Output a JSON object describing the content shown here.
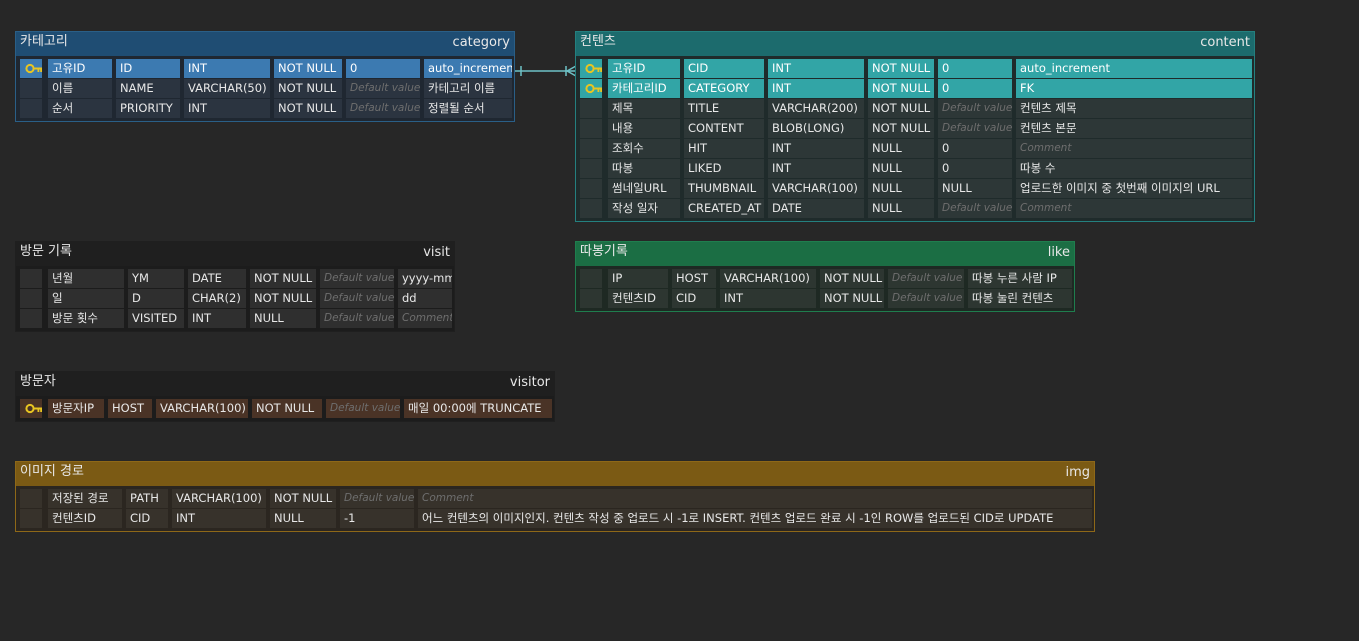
{
  "colors": {
    "category": {
      "head": "#1f4d73",
      "border": "#2a5f87",
      "body": "#1f2731",
      "cell": "#2b3440",
      "sel": "#3c7ab1"
    },
    "content": {
      "head": "#1c6b6d",
      "border": "#24807f",
      "body": "#1f2b2b",
      "cell": "#2d3737",
      "sel": "#32a5a6"
    },
    "visit": {
      "head": "#1f1f1f",
      "border": "#1f1f1f",
      "body": "#1c1c1c",
      "cell": "#2f2f2f",
      "sel": "#3a3a3a"
    },
    "like": {
      "head": "#1b6e44",
      "border": "#1f7e4e",
      "body": "#1e2923",
      "cell": "#2d3631",
      "sel": "#2d8d5b"
    },
    "visitor": {
      "head": "#1f1f1f",
      "border": "#1f1f1f",
      "body": "#1c1c1c",
      "cell": "#4a3326",
      "sel": "#4a3326"
    },
    "img": {
      "head": "#7b5a14",
      "border": "#8e6818",
      "body": "#2b2620",
      "cell": "#37322b",
      "sel": "#5a4419"
    },
    "key": "#e8c521",
    "connector": "#6ec2c7"
  },
  "tables": {
    "category": {
      "title": "카테고리",
      "name": "category",
      "rows": [
        {
          "key": true,
          "selected": true,
          "cells": [
            "고유ID",
            "ID",
            "INT",
            "NOT NULL",
            "0",
            "auto_increment"
          ]
        },
        {
          "key": false,
          "selected": false,
          "cells": [
            "이름",
            "NAME",
            "VARCHAR(50)",
            "NOT NULL",
            "Default value",
            "카테고리 이름"
          ],
          "ph": [
            4
          ]
        },
        {
          "key": false,
          "selected": false,
          "cells": [
            "순서",
            "PRIORITY",
            "INT",
            "NOT NULL",
            "Default value",
            "정렬될 순서"
          ],
          "ph": [
            4
          ]
        }
      ]
    },
    "content": {
      "title": "컨텐츠",
      "name": "content",
      "rows": [
        {
          "key": true,
          "selected": true,
          "cells": [
            "고유ID",
            "CID",
            "INT",
            "NOT NULL",
            "0",
            "auto_increment"
          ]
        },
        {
          "key": true,
          "selected": true,
          "cells": [
            "카테고리ID",
            "CATEGORY",
            "INT",
            "NOT NULL",
            "0",
            "FK"
          ]
        },
        {
          "key": false,
          "selected": false,
          "cells": [
            "제목",
            "TITLE",
            "VARCHAR(200)",
            "NOT NULL",
            "Default value",
            "컨텐츠 제목"
          ],
          "ph": [
            4
          ]
        },
        {
          "key": false,
          "selected": false,
          "cells": [
            "내용",
            "CONTENT",
            "BLOB(LONG)",
            "NOT NULL",
            "Default value",
            "컨텐츠 본문"
          ],
          "ph": [
            4
          ]
        },
        {
          "key": false,
          "selected": false,
          "cells": [
            "조회수",
            "HIT",
            "INT",
            "NULL",
            "0",
            "Comment"
          ],
          "ph": [
            5
          ]
        },
        {
          "key": false,
          "selected": false,
          "cells": [
            "따봉",
            "LIKED",
            "INT",
            "NULL",
            "0",
            "따봉 수"
          ]
        },
        {
          "key": false,
          "selected": false,
          "cells": [
            "썸네일URL",
            "THUMBNAIL",
            "VARCHAR(100)",
            "NULL",
            "NULL",
            "업로드한 이미지 중 첫번째 이미지의 URL"
          ]
        },
        {
          "key": false,
          "selected": false,
          "cells": [
            "작성 일자",
            "CREATED_AT",
            "DATE",
            "NULL",
            "Default value",
            "Comment"
          ],
          "ph": [
            4,
            5
          ]
        }
      ]
    },
    "visit": {
      "title": "방문 기록",
      "name": "visit",
      "rows": [
        {
          "key": false,
          "selected": false,
          "cells": [
            "년월",
            "YM",
            "DATE",
            "NOT NULL",
            "Default value",
            "yyyy-mm"
          ],
          "ph": [
            4
          ]
        },
        {
          "key": false,
          "selected": false,
          "cells": [
            "일",
            "D",
            "CHAR(2)",
            "NOT NULL",
            "Default value",
            "dd"
          ],
          "ph": [
            4
          ]
        },
        {
          "key": false,
          "selected": false,
          "cells": [
            "방문 횟수",
            "VISITED",
            "INT",
            "NULL",
            "Default value",
            "Comment"
          ],
          "ph": [
            4,
            5
          ]
        }
      ]
    },
    "like": {
      "title": "따봉기록",
      "name": "like",
      "rows": [
        {
          "key": false,
          "selected": false,
          "cells": [
            "IP",
            "HOST",
            "VARCHAR(100)",
            "NOT NULL",
            "Default value",
            "따봉 누른 사람 IP"
          ],
          "ph": [
            4
          ]
        },
        {
          "key": false,
          "selected": false,
          "cells": [
            "컨텐츠ID",
            "CID",
            "INT",
            "NOT NULL",
            "Default value",
            "따봉 눌린 컨텐츠"
          ],
          "ph": [
            4
          ]
        }
      ]
    },
    "visitor": {
      "title": "방문자",
      "name": "visitor",
      "rows": [
        {
          "key": true,
          "selected": false,
          "cells": [
            "방문자IP",
            "HOST",
            "VARCHAR(100)",
            "NOT NULL",
            "Default value",
            "매일 00:00에 TRUNCATE"
          ],
          "ph": [
            4
          ]
        }
      ]
    },
    "img": {
      "title": "이미지 경로",
      "name": "img",
      "rows": [
        {
          "key": false,
          "selected": false,
          "cells": [
            "저장된 경로",
            "PATH",
            "VARCHAR(100)",
            "NOT NULL",
            "Default value",
            "Comment"
          ],
          "ph": [
            4,
            5
          ]
        },
        {
          "key": false,
          "selected": false,
          "cells": [
            "컨텐츠ID",
            "CID",
            "INT",
            "NULL",
            "-1",
            "어느 컨텐츠의 이미지인지. 컨텐츠 작성 중 업로드 시 -1로 INSERT. 컨텐츠 업로드 완료 시 -1인 ROW를 업로드된 CID로 UPDATE"
          ]
        }
      ]
    }
  }
}
